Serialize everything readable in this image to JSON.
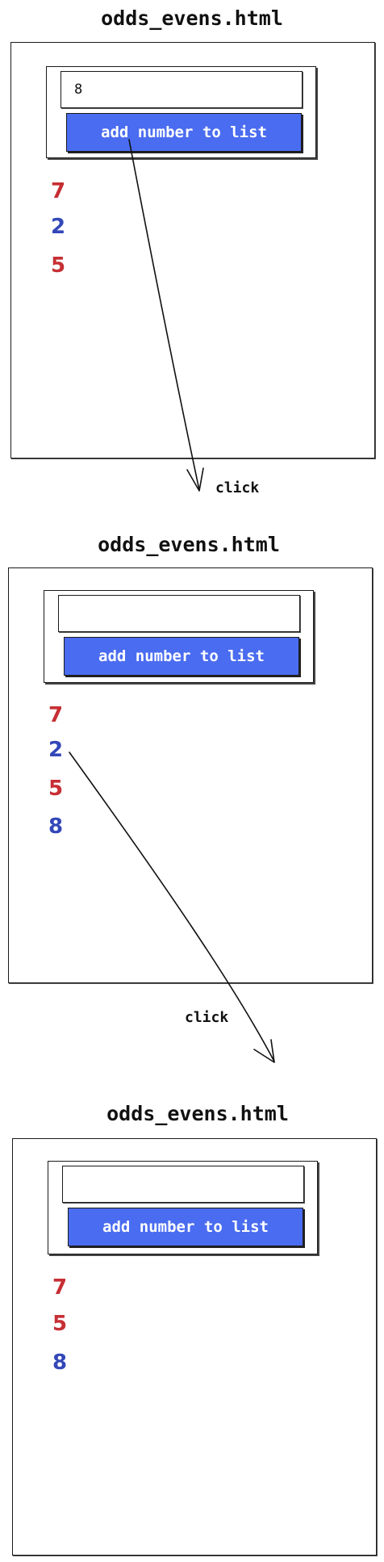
{
  "frames": [
    {
      "title": "odds_evens.html",
      "input_value": "8",
      "button_label": "add number to list",
      "numbers": [
        {
          "value": "7",
          "parity": "odd"
        },
        {
          "value": "2",
          "parity": "even"
        },
        {
          "value": "5",
          "parity": "odd"
        }
      ]
    },
    {
      "title": "odds_evens.html",
      "input_value": "",
      "button_label": "add number to list",
      "numbers": [
        {
          "value": "7",
          "parity": "odd"
        },
        {
          "value": "2",
          "parity": "even"
        },
        {
          "value": "5",
          "parity": "odd"
        },
        {
          "value": "8",
          "parity": "even"
        }
      ]
    },
    {
      "title": "odds_evens.html",
      "input_value": "",
      "button_label": "add number to list",
      "numbers": [
        {
          "value": "7",
          "parity": "odd"
        },
        {
          "value": "5",
          "parity": "odd"
        },
        {
          "value": "8",
          "parity": "even"
        }
      ]
    }
  ],
  "arrows": [
    {
      "label": "click"
    },
    {
      "label": "click"
    }
  ],
  "colors": {
    "odd": "#c62f34",
    "even": "#3347b8",
    "button": "#4a6cf0"
  }
}
